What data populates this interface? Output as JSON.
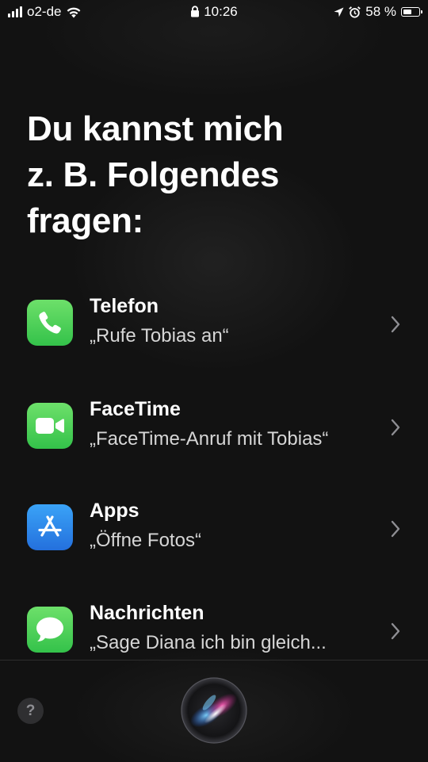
{
  "status_bar": {
    "carrier": "o2-de",
    "time": "10:26",
    "battery_percent": "58 %",
    "battery_level": 0.58
  },
  "heading": {
    "lines": [
      "Du kannst mich",
      "z. B. Folgendes",
      "fragen:"
    ]
  },
  "suggestions": [
    {
      "title": "Telefon",
      "subtitle": "„Rufe Tobias an“",
      "icon": "phone-icon"
    },
    {
      "title": "FaceTime",
      "subtitle": "„FaceTime-Anruf mit Tobias“",
      "icon": "video-camera-icon"
    },
    {
      "title": "Apps",
      "subtitle": "„Öffne Fotos“",
      "icon": "app-store-icon"
    },
    {
      "title": "Nachrichten",
      "subtitle": "„Sage Diana ich bin gleich...",
      "icon": "message-bubble-icon"
    }
  ],
  "footer": {
    "help_label": "?"
  },
  "colors": {
    "background": "#121212",
    "green_icon": "#4cd964",
    "blue_icon": "#2d88f0"
  }
}
